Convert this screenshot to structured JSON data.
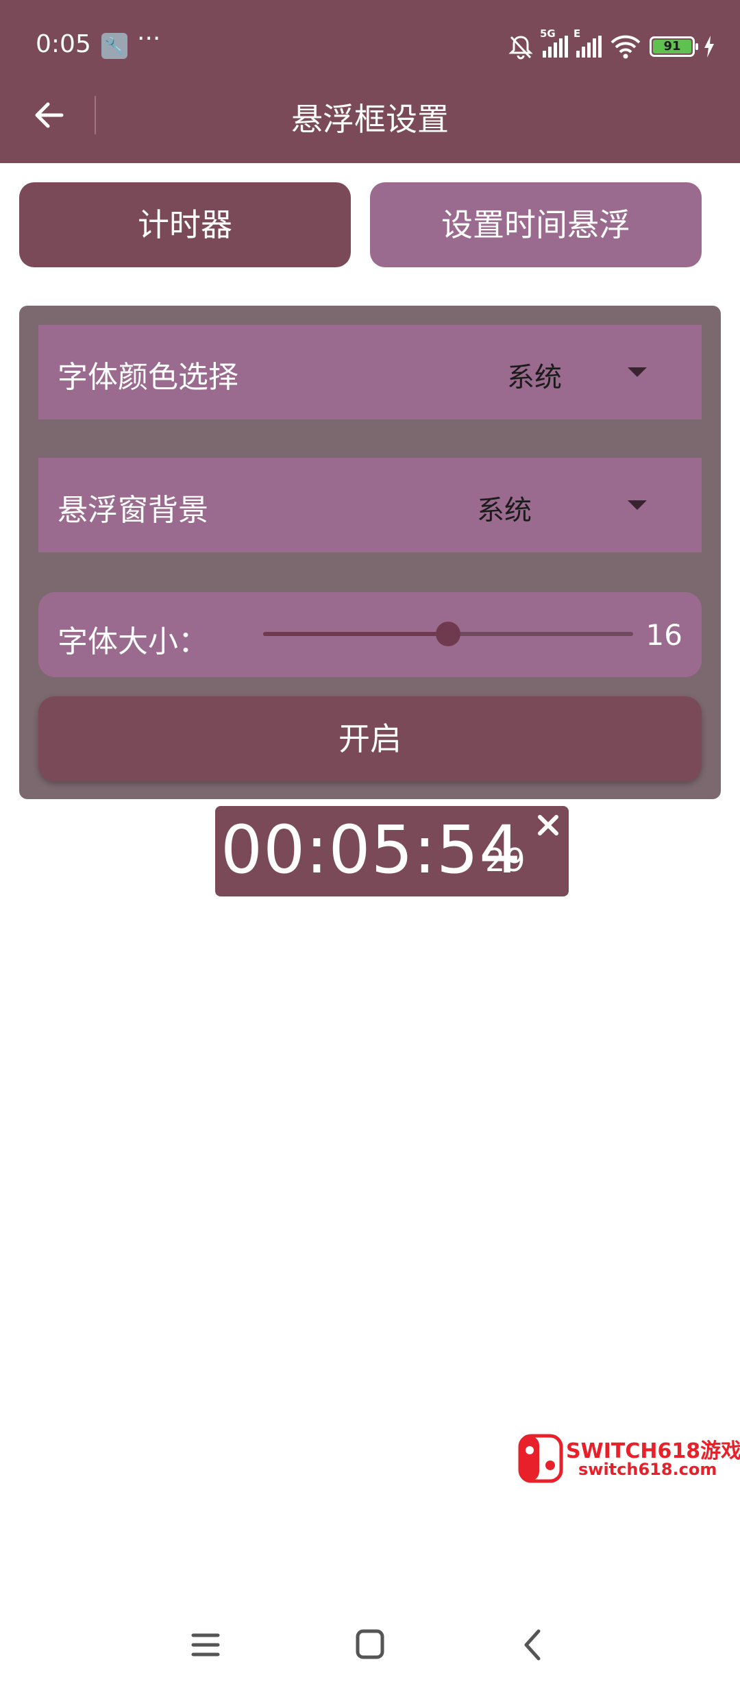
{
  "status_bar": {
    "time": "0:05",
    "more": "···",
    "network_1": "5G",
    "network_2": "E",
    "battery_level": "91"
  },
  "toolbar": {
    "title": "悬浮框设置"
  },
  "tabs": [
    {
      "label": "计时器"
    },
    {
      "label": "设置时间悬浮"
    }
  ],
  "settings": {
    "font_color": {
      "label": "字体颜色选择",
      "value": "系统"
    },
    "window_background": {
      "label": "悬浮窗背景",
      "value": "系统"
    },
    "font_size": {
      "label": "字体大小：",
      "value": "16",
      "slider_fraction": 0.5
    },
    "start_button": "开启"
  },
  "floating_timer": {
    "time": "00:05:54",
    "fraction": "29"
  },
  "watermark": {
    "line1": "SWITCH618游戏",
    "line2": "switch618.com"
  },
  "colors": {
    "primary": "#7b4a59",
    "accent": "#9a6b8e",
    "panel": "#7c686f",
    "watermark": "#e8202a"
  }
}
